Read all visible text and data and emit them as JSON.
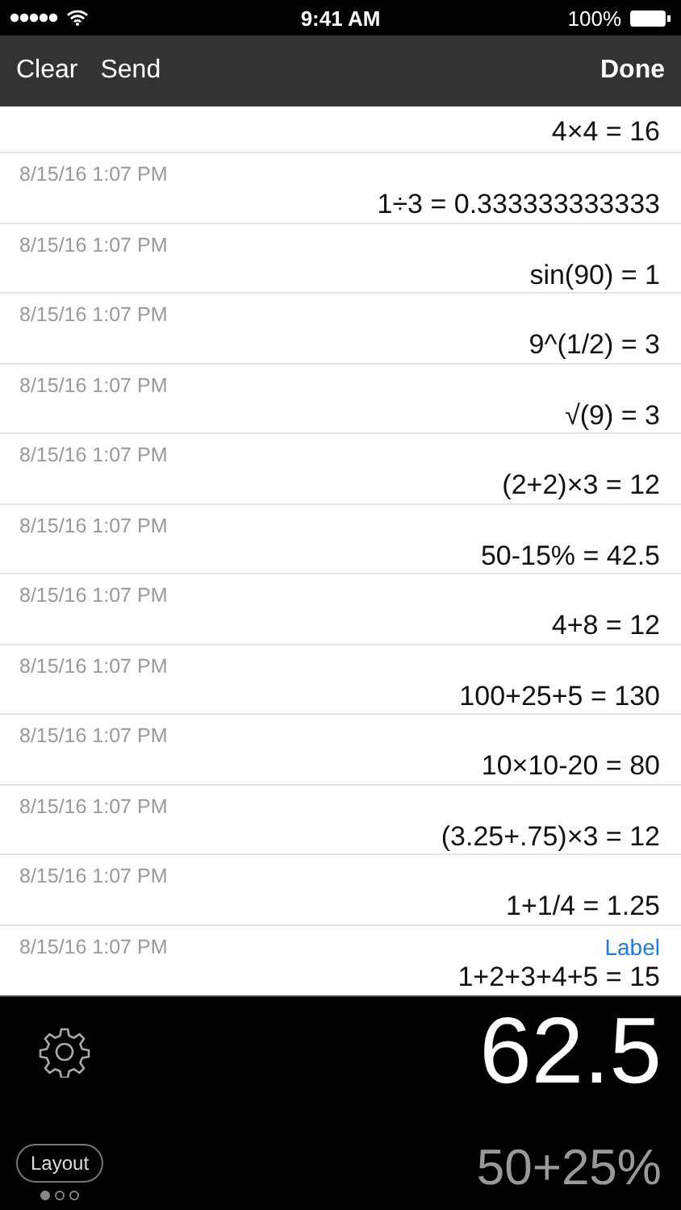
{
  "status_bar": {
    "time": "9:41 AM",
    "battery": "100%"
  },
  "nav": {
    "left_buttons": [
      "Clear",
      "Send"
    ],
    "right_button": "Done"
  },
  "history": [
    {
      "expression": "4×4 = 16"
    },
    {
      "date": "8/15/16 1:07 PM",
      "expression": "1÷3 = 0.333333333333"
    },
    {
      "date": "8/15/16 1:07 PM",
      "expression": "sin(90) = 1"
    },
    {
      "date": "8/15/16 1:07 PM",
      "expression": "9^(1/2) = 3"
    },
    {
      "date": "8/15/16 1:07 PM",
      "expression": "√(9) = 3"
    },
    {
      "date": "8/15/16 1:07 PM",
      "expression": "(2+2)×3 = 12"
    },
    {
      "date": "8/15/16 1:07 PM",
      "expression": "50-15% = 42.5"
    },
    {
      "date": "8/15/16 1:07 PM",
      "expression": "4+8 = 12"
    },
    {
      "date": "8/15/16 1:07 PM",
      "expression": "100+25+5 = 130"
    },
    {
      "date": "8/15/16 1:07 PM",
      "expression": "10×10-20 = 80"
    },
    {
      "date": "8/15/16 1:07 PM",
      "expression": "(3.25+.75)×3 = 12"
    },
    {
      "date": "8/15/16 1:07 PM",
      "expression": "1+1/4 = 1.25"
    },
    {
      "date": "8/15/16 1:07 PM",
      "label": "Label",
      "expression": "1+2+3+4+5 = 15"
    }
  ],
  "display": {
    "result": "62.5",
    "expression": "50+25%"
  },
  "layout_button": "Layout",
  "pages": [
    {
      "selected": true
    },
    {
      "selected": false
    },
    {
      "selected": false
    }
  ]
}
